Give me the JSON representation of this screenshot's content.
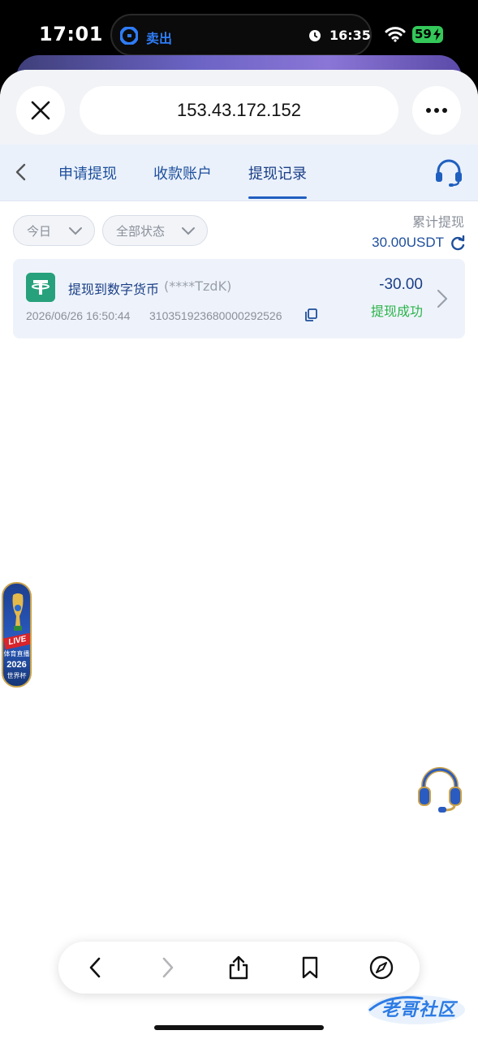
{
  "status_bar": {
    "time": "17:01",
    "island_app": "卖出",
    "island_time": "16:35",
    "battery": "59"
  },
  "browser": {
    "url": "153.43.172.152"
  },
  "header": {
    "tabs": [
      {
        "label": "申请提现",
        "active": false
      },
      {
        "label": "收款账户",
        "active": false
      },
      {
        "label": "提现记录",
        "active": true
      }
    ]
  },
  "filters": {
    "date": "今日",
    "status": "全部状态"
  },
  "summary": {
    "label": "累计提现",
    "value": "30.00USDT"
  },
  "records": [
    {
      "title": "提现到数字货币",
      "account_mask": "(****TzdK)",
      "time": "2026/06/26 16:50:44",
      "order_id": "3103519236800002925​26",
      "amount": "-30.00",
      "status": "提现成功"
    }
  ],
  "live_badge": {
    "tag": "LIVE",
    "line1": "体育直播",
    "year": "2026",
    "line2": "世界杯"
  },
  "watermark": "老哥社区",
  "colors": {
    "brand_blue": "#1e4f9c",
    "success_green": "#2bb34a",
    "tether_green": "#26a17b",
    "tab_background": "#eaf1fb"
  }
}
